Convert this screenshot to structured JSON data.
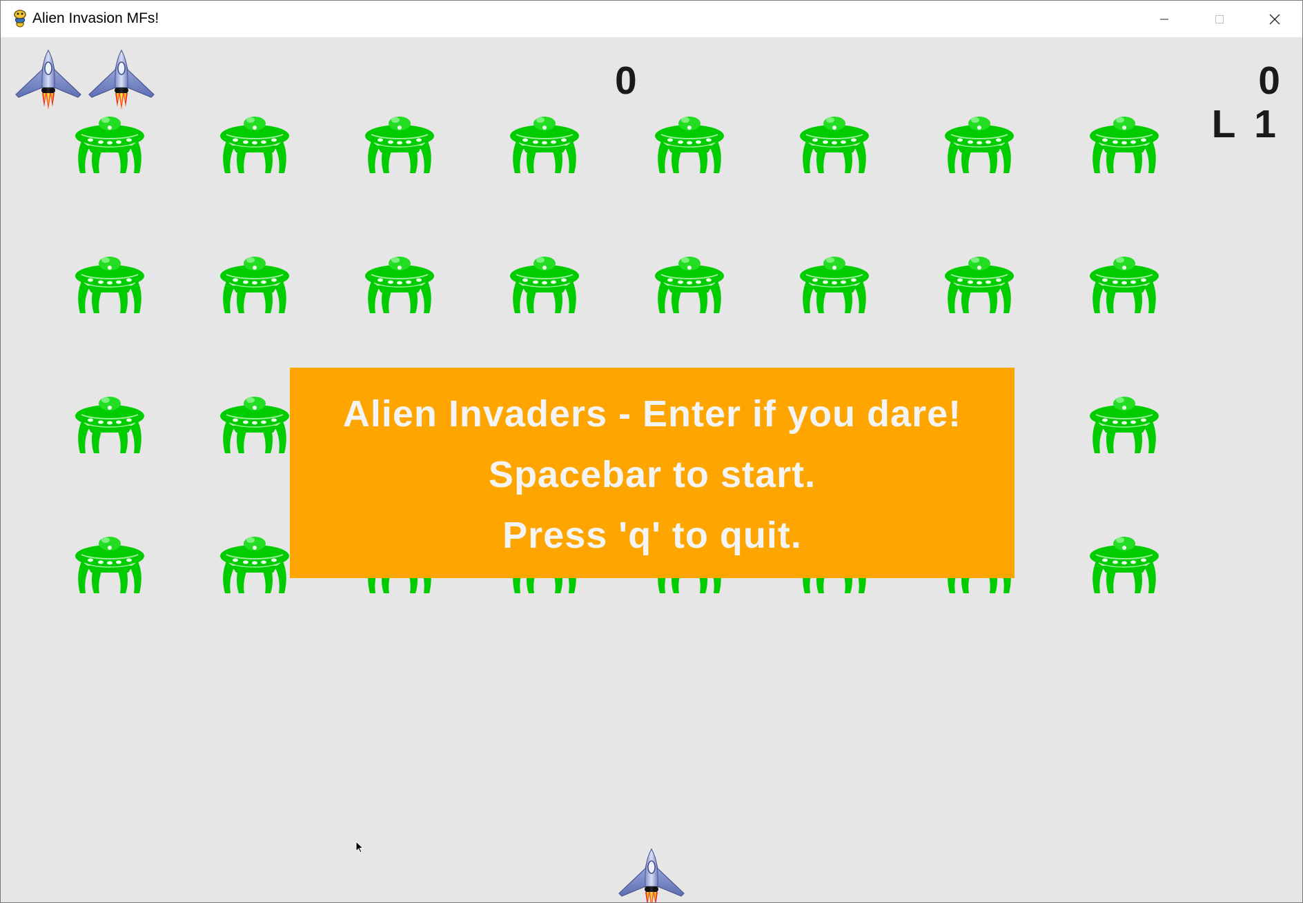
{
  "window": {
    "title": "Alien Invasion MFs!",
    "icon": "pygame-snake-icon",
    "controls": [
      "minimize-icon",
      "maximize-icon",
      "close-icon"
    ]
  },
  "hud": {
    "score": "0",
    "high_score": "0",
    "level": "L 1",
    "ships_remaining": 2
  },
  "banner": {
    "line1": "Alien Invaders - Enter if you dare!",
    "line2": "Spacebar to start.",
    "line3": "Press 'q' to quit."
  },
  "fleet": {
    "rows": 4,
    "columns": 8,
    "alien_color": "#00cc00",
    "alien_icon": "ufo-alien-icon"
  },
  "colors": {
    "background": "#e6e6e6",
    "banner": "#ffa500",
    "banner_text": "#f4f4f4",
    "hud_text": "#1a1a1a",
    "alien": "#00cc00"
  }
}
